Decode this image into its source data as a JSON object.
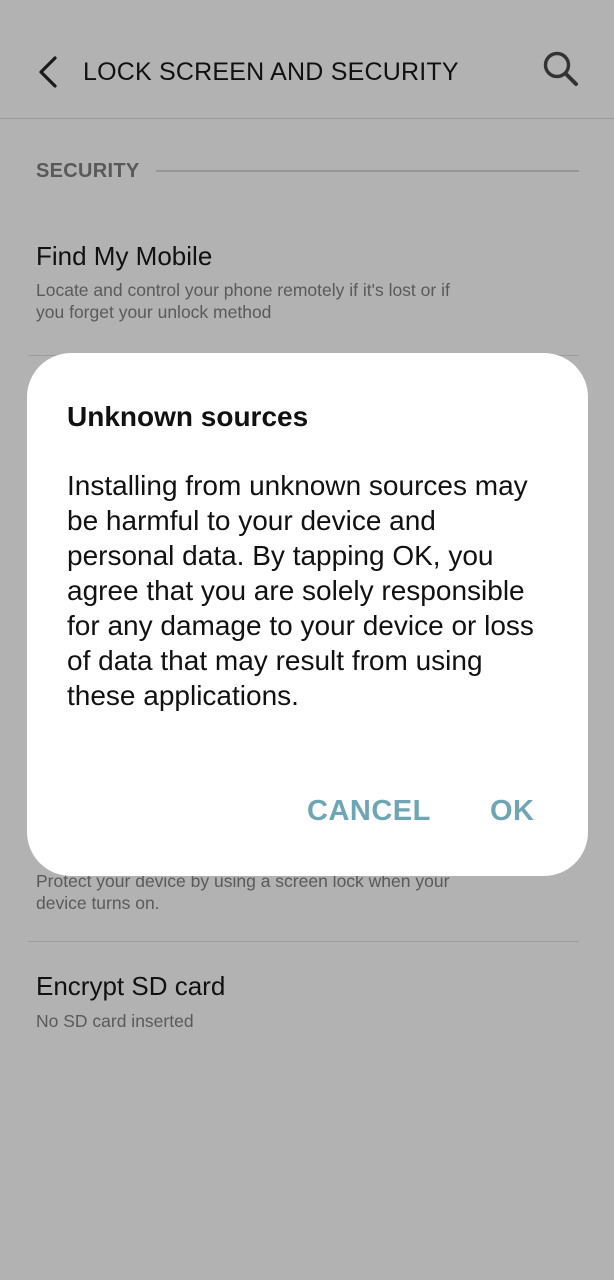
{
  "header": {
    "title": "LOCK SCREEN AND SECURITY",
    "back_icon": "chevron-left-icon",
    "search_icon": "search-icon"
  },
  "section": {
    "label": "SECURITY"
  },
  "items": [
    {
      "title": "Find My Mobile",
      "subtitle": "Locate and control your phone remotely if it's lost or if you forget your unlock method"
    },
    {
      "title": "",
      "subtitle": "Protect your device by using a screen lock when your device turns on."
    },
    {
      "title": "Encrypt SD card",
      "subtitle": "No SD card inserted"
    }
  ],
  "dialog": {
    "title": "Unknown sources",
    "body": "Installing from unknown sources may be harmful to your device and personal data. By tapping OK, you agree that you are solely responsible for any damage to your device or loss of data that may result from using these applications.",
    "cancel_label": "CANCEL",
    "ok_label": "OK"
  },
  "colors": {
    "scrim_background": "#b2b2b2",
    "dialog_background": "#ffffff",
    "accent": "#6fa6b6"
  }
}
